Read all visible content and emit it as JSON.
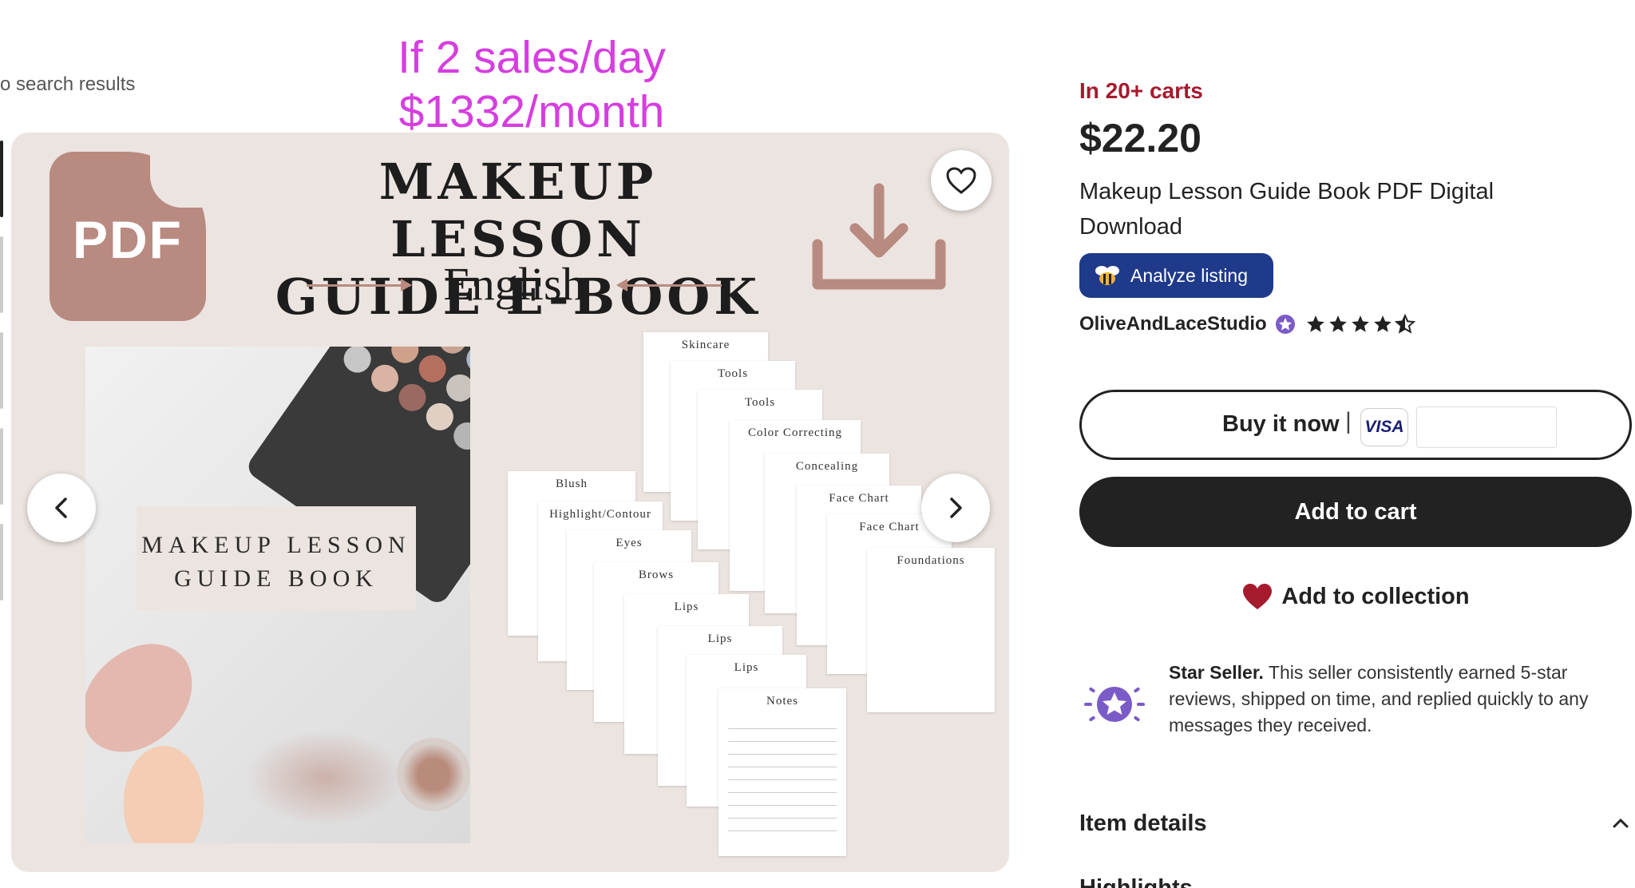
{
  "nav": {
    "back_link": "o search results"
  },
  "overlay": {
    "line1": "If 2 sales/day",
    "line2": "$1332/month",
    "color": "#d63ee0"
  },
  "hero": {
    "badge_text": "PDF",
    "title_line1": "MAKEUP LESSON",
    "title_line2": "GUIDE E-BOOK",
    "language": "English",
    "cover_title_line1": "MAKEUP LESSON",
    "cover_title_line2": "GUIDE BOOK",
    "pages": [
      "Skincare",
      "Tools",
      "Tools",
      "Color Correcting",
      "Concealing",
      "Face Chart",
      "Face Chart",
      "Foundations",
      "Blush",
      "Highlight/Contour",
      "Eyes",
      "Brows",
      "Lips",
      "Lips",
      "Lips",
      "Notes"
    ],
    "prev_icon": "chevron-left-icon",
    "next_icon": "chevron-right-icon",
    "favorite_icon": "heart-outline-icon",
    "download_icon": "download-icon"
  },
  "listing": {
    "carts": "In 20+ carts",
    "price": "$22.20",
    "title": "Makeup Lesson Guide Book PDF Digital Download",
    "analyze_label": "Analyze listing",
    "seller_name": "OliveAndLaceStudio",
    "rating": 4.5,
    "rating_max": 5,
    "buy_now_label": "Buy it now",
    "buy_sep": "|",
    "visa_label": "VISA",
    "add_to_cart_label": "Add to cart",
    "add_to_collection_label": "Add to collection",
    "star_seller_bold": "Star Seller.",
    "star_seller_text": " This seller consistently earned 5-star reviews, shipped on time, and replied quickly to any messages they received.",
    "item_details_label": "Item details",
    "highlights_label": "Highlights",
    "colors": {
      "carts_red": "#a61a2e",
      "analyze_blue": "#1f3a8a",
      "accent_purple": "#7a5bc7",
      "heart_red": "#a61a2e"
    }
  }
}
